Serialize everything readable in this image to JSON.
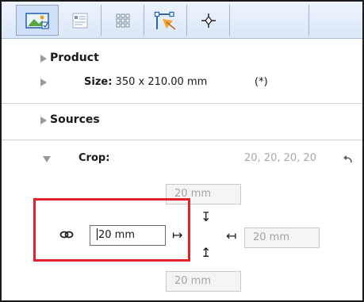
{
  "tabs": [
    {
      "icon": "image-landscape-icon",
      "active": true
    },
    {
      "icon": "text-layout-icon",
      "active": false
    },
    {
      "icon": "grid-icon",
      "active": false
    },
    {
      "icon": "bezier-path-icon",
      "active": false
    },
    {
      "icon": "crosshair-icon",
      "active": false
    }
  ],
  "product": {
    "label": "Product",
    "size_label": "Size:",
    "size_value": "350 x 210.00 mm",
    "size_note": "(*)"
  },
  "sources": {
    "label": "Sources"
  },
  "crop": {
    "label": "Crop:",
    "summary": "20, 20, 20, 20",
    "top_value": "20 mm",
    "left_value": "20 mm",
    "right_value": "20 mm",
    "bottom_value": "20 mm"
  },
  "colors": {
    "highlight": "#e0232a",
    "tab_active": "#cfe0f6"
  }
}
